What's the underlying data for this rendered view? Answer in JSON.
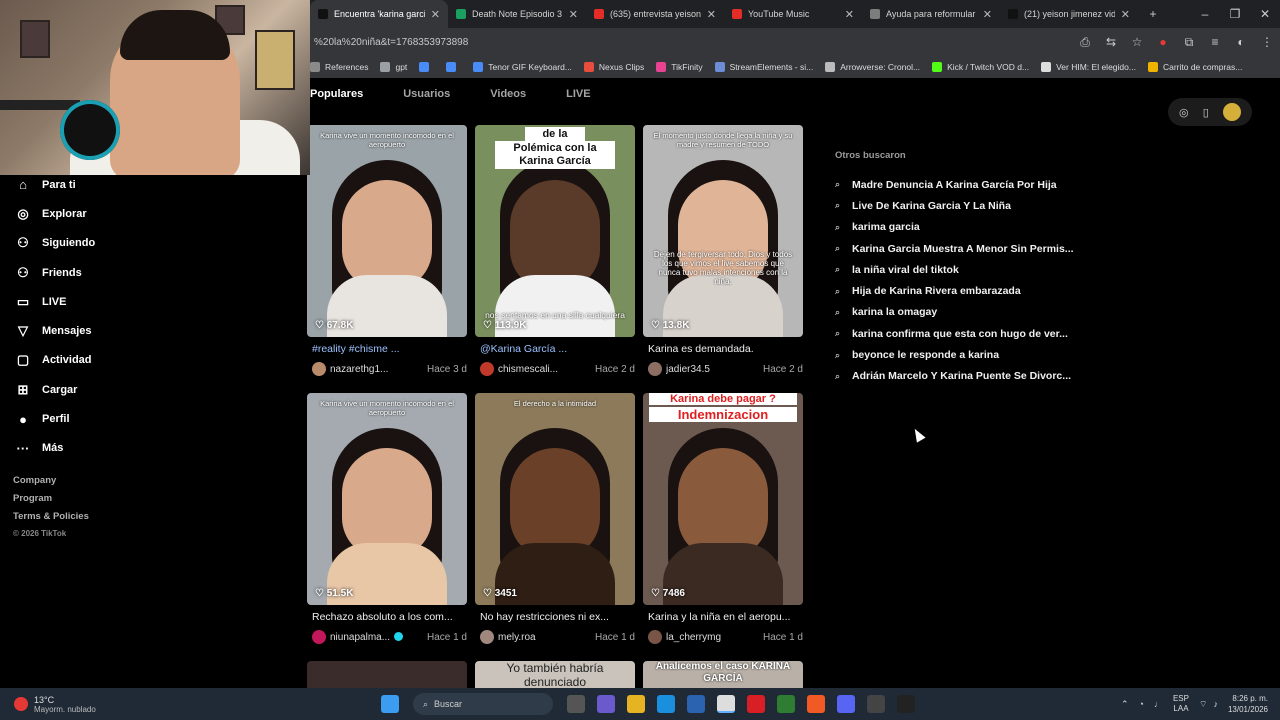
{
  "browser": {
    "tabs": [
      {
        "title": "Encuentra 'karina garcia y",
        "color": "#111111",
        "active": true
      },
      {
        "title": "Death Note Episodio 3 Su",
        "color": "#1aa15f",
        "active": false
      },
      {
        "title": "(635) entrevista yeison jim",
        "color": "#e52d27",
        "active": false
      },
      {
        "title": "YouTube Music",
        "color": "#e52d27",
        "active": false
      },
      {
        "title": "Ayuda para reformular so",
        "color": "#7d7d7d",
        "active": false
      },
      {
        "title": "(21) yeison jimenez video",
        "color": "#111111",
        "active": false
      }
    ],
    "url": "%20la%20niña&t=1768353973898",
    "bookmarks": [
      {
        "label": "References",
        "color": "#8a8a8a"
      },
      {
        "label": "gpt",
        "color": "#9aa0a6"
      },
      {
        "label": "",
        "color": "#4a8cf7"
      },
      {
        "label": "",
        "color": "#4a8cf7"
      },
      {
        "label": "Tenor GIF Keyboard...",
        "color": "#4a8cf7"
      },
      {
        "label": "Nexus Clips",
        "color": "#e74c3c"
      },
      {
        "label": "TikFinity",
        "color": "#e84393"
      },
      {
        "label": "StreamElements - si...",
        "color": "#6c8cd5"
      },
      {
        "label": "Arrowverse: Cronol...",
        "color": "#bbbbbb"
      },
      {
        "label": "Kick / Twitch VOD d...",
        "color": "#53fc18"
      },
      {
        "label": "Ver HIM: El elegido...",
        "color": "#dddddd"
      },
      {
        "label": "Carrito de compras...",
        "color": "#f0b400"
      }
    ]
  },
  "sidebar": {
    "items": [
      {
        "label": "Para ti",
        "icon": "⌂"
      },
      {
        "label": "Explorar",
        "icon": "◎"
      },
      {
        "label": "Siguiendo",
        "icon": "⚇"
      },
      {
        "label": "Friends",
        "icon": "⚇"
      },
      {
        "label": "LIVE",
        "icon": "▭"
      },
      {
        "label": "Mensajes",
        "icon": "▽"
      },
      {
        "label": "Actividad",
        "icon": "▢"
      },
      {
        "label": "Cargar",
        "icon": "⊞"
      },
      {
        "label": "Perfil",
        "icon": "●"
      },
      {
        "label": "Más",
        "icon": "···"
      }
    ],
    "footer": [
      "Company",
      "Program",
      "Terms & Policies"
    ],
    "copyright": "© 2026 TikTok"
  },
  "search_tabs": [
    "Populares",
    "Usuarios",
    "Videos",
    "LIVE"
  ],
  "videos": [
    {
      "likes": "67.8K",
      "title": "#reality #chisme ...",
      "tag": true,
      "user": "nazarethg1...",
      "ago": "Hace 3 d",
      "caption": "Karina vive un momento incomodo en el aeropuerto",
      "skin": "#d9a98c",
      "bg": "#9aa3a8",
      "body": "#e8e4df",
      "capstyle": "top",
      "avatar": "#b98b6a",
      "verified": false
    },
    {
      "likes": "113.9K",
      "title": "@Karina García ...",
      "tag": true,
      "user": "chismescali...",
      "ago": "Hace 2 d",
      "caption": "Polémica con la Karina García",
      "caption2": "nos sentamos en una silla cualquiera",
      "pre": "de la",
      "skin": "#5a3a28",
      "bg": "#7a8f5e",
      "body": "#f1f1f1",
      "capstyle": "box",
      "avatar": "#c0392b",
      "verified": false
    },
    {
      "likes": "13.8K",
      "title": "Karina es demandada.",
      "tag": false,
      "user": "jadier34.5",
      "ago": "Hace 2 d",
      "caption": "El momento justo donde llega la niña y su madre y resumen de TODO",
      "caption2": "Dejen de tergiversar todo. Dios y todos los que vimos el live sabemos que nunca tuvo malas intenciones con la niña.",
      "skin": "#e0b497",
      "bg": "#b7b7b7",
      "body": "#d8d2cc",
      "capstyle": "top",
      "avatar": "#8d6e63",
      "verified": false
    },
    {
      "likes": "51.5K",
      "title": "Rechazo absoluto a los com...",
      "tag": false,
      "user": "niunapalma...",
      "ago": "Hace 1 d",
      "caption": "Karina vive un momento incomodo en el aeropuerto",
      "skin": "#d9a98c",
      "bg": "#a4aab0",
      "body": "#e8c7a7",
      "capstyle": "top",
      "avatar": "#c2185b",
      "verified": true
    },
    {
      "likes": "3451",
      "title": "No hay restricciones ni ex...",
      "tag": false,
      "user": "mely.roa",
      "ago": "Hace 1 d",
      "caption": "El derecho a la intimidad",
      "skin": "#6b4028",
      "bg": "#8c7a5a",
      "body": "#2e1e14",
      "capstyle": "top",
      "avatar": "#a1887f",
      "verified": false
    },
    {
      "likes": "7486",
      "title": "Karina y la niña en el aeropu...",
      "tag": false,
      "user": "la_cherrymg",
      "ago": "Hace 1 d",
      "caption": "Karina debe pagar ?",
      "caption2": "Indemnizacion",
      "skin": "#8a5a3c",
      "bg": "#6c5a50",
      "body": "#3a2a22",
      "capstyle": "red",
      "avatar": "#795548",
      "verified": false
    }
  ],
  "partial_captions": [
    "Yo también habría denunciado",
    "Analicemos el caso KARINA GARCÍA"
  ],
  "right_panel": {
    "heading": "Otros buscaron",
    "suggestions": [
      "Madre Denuncia A Karina García Por Hija",
      "Live De Karina Garcia Y La Niña",
      "karima garcia",
      "Karina Garcia Muestra A Menor Sin Permis...",
      "la niña viral del tiktok",
      "Hija de Karina Rivera embarazada",
      "karina la omagay",
      "karina confirma que esta con hugo de ver...",
      "beyonce le responde a karina",
      "Adrián Marcelo Y Karina Puente Se Divorc..."
    ]
  },
  "taskbar": {
    "weather_temp": "13°C",
    "weather_desc": "Mayorm. nublado",
    "search_placeholder": "Buscar",
    "lang1": "ESP",
    "lang2": "LAA",
    "time": "8:26 p. m.",
    "date": "13/01/2026"
  }
}
